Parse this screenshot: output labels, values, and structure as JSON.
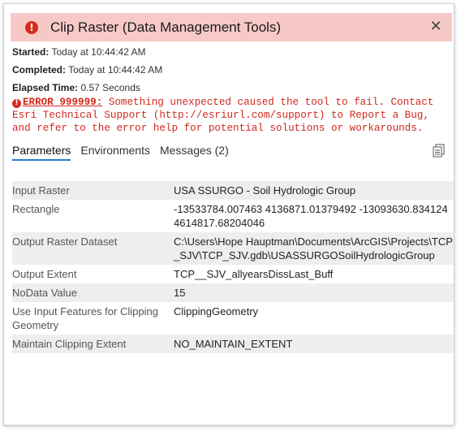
{
  "dialog": {
    "title": "Clip Raster (Data Management Tools)",
    "title_icon": "error-icon",
    "close_label": "✕"
  },
  "meta": {
    "started_label": "Started:",
    "started_value": "Today at 10:44:42 AM",
    "completed_label": "Completed:",
    "completed_value": "Today at 10:44:42 AM",
    "elapsed_label": "Elapsed Time:",
    "elapsed_value": "0.57 Seconds"
  },
  "error": {
    "code": "ERROR 999999:",
    "message": "Something unexpected caused the tool to fail. Contact Esri Technical Support (http://esriurl.com/support) to Report a Bug, and refer to the error help for potential solutions or workarounds.",
    "color": "#d0281d"
  },
  "tabs": [
    {
      "label": "Parameters",
      "active": true
    },
    {
      "label": "Environments",
      "active": false
    },
    {
      "label": "Messages (2)",
      "active": false
    }
  ],
  "parameters": [
    {
      "name": "Input Raster",
      "value": "USA SSURGO - Soil Hydrologic Group"
    },
    {
      "name": "Rectangle",
      "value": "-13533784.007463 4136871.01379492 -13093630.834124 4614817.68204046"
    },
    {
      "name": "Output Raster Dataset",
      "value": "C:\\Users\\Hope Hauptman\\Documents\\ArcGIS\\Projects\\TCP_SJV\\TCP_SJV.gdb\\USASSURGOSoilHydrologicGroup"
    },
    {
      "name": "Output Extent",
      "value": "TCP__SJV_allyearsDissLast_Buff"
    },
    {
      "name": "NoData Value",
      "value": "15"
    },
    {
      "name": "Use Input Features for Clipping Geometry",
      "value": "ClippingGeometry"
    },
    {
      "name": "Maintain Clipping Extent",
      "value": "NO_MAINTAIN_EXTENT"
    }
  ],
  "colors": {
    "title_bar": "#f7c9c6",
    "error_red": "#d52b1e",
    "tab_underline": "#2b7bd3",
    "row_shade": "#eeeeee"
  }
}
